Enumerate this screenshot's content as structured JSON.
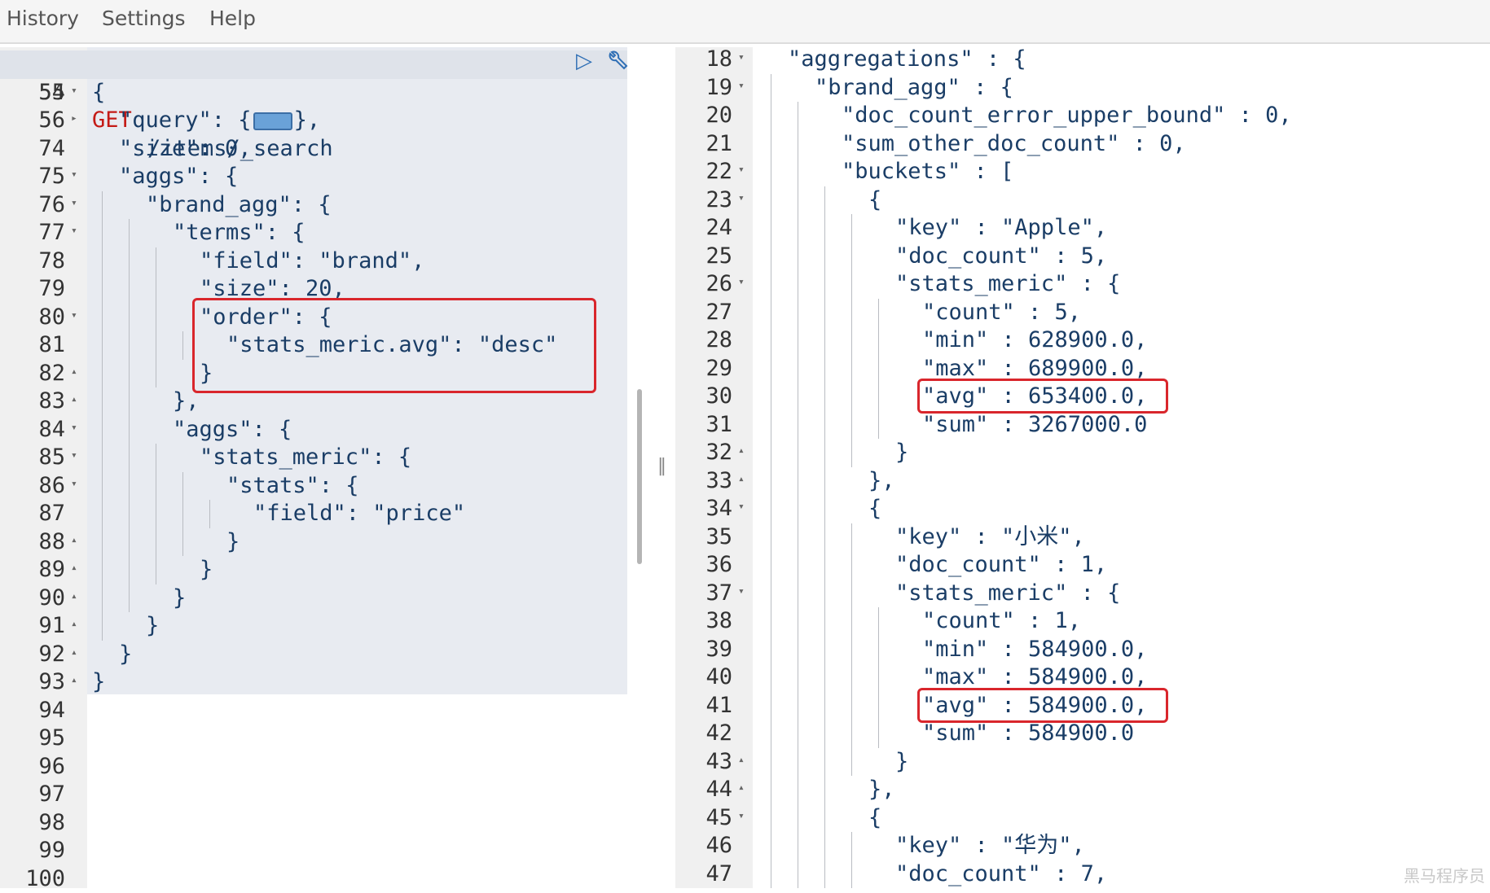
{
  "menu": {
    "history": "History",
    "settings": "Settings",
    "help": "Help"
  },
  "request": {
    "method": "GET",
    "path": "/items/_search",
    "lines": [
      {
        "num": "55",
        "fold": "▾",
        "indent": 0,
        "text": "{"
      },
      {
        "num": "56",
        "fold": "▸",
        "indent": 1,
        "text": "\"query\": {",
        "collapsed": true,
        "after": "},"
      },
      {
        "num": "74",
        "fold": "",
        "indent": 1,
        "text": "\"size\": 0,"
      },
      {
        "num": "75",
        "fold": "▾",
        "indent": 1,
        "text": "\"aggs\": {"
      },
      {
        "num": "76",
        "fold": "▾",
        "indent": 2,
        "text": "\"brand_agg\": {"
      },
      {
        "num": "77",
        "fold": "▾",
        "indent": 3,
        "text": "\"terms\": {"
      },
      {
        "num": "78",
        "fold": "",
        "indent": 4,
        "text": "\"field\": \"brand\","
      },
      {
        "num": "79",
        "fold": "",
        "indent": 4,
        "text": "\"size\": 20,"
      },
      {
        "num": "80",
        "fold": "▾",
        "indent": 4,
        "text": "\"order\": {"
      },
      {
        "num": "81",
        "fold": "",
        "indent": 5,
        "text": "\"stats_meric.avg\": \"desc\""
      },
      {
        "num": "82",
        "fold": "▴",
        "indent": 4,
        "text": "}"
      },
      {
        "num": "83",
        "fold": "▴",
        "indent": 3,
        "text": "},"
      },
      {
        "num": "84",
        "fold": "▾",
        "indent": 3,
        "text": "\"aggs\": {"
      },
      {
        "num": "85",
        "fold": "▾",
        "indent": 4,
        "text": "\"stats_meric\": {"
      },
      {
        "num": "86",
        "fold": "▾",
        "indent": 5,
        "text": "\"stats\": {"
      },
      {
        "num": "87",
        "fold": "",
        "indent": 6,
        "text": "\"field\": \"price\""
      },
      {
        "num": "88",
        "fold": "▴",
        "indent": 5,
        "text": "}"
      },
      {
        "num": "89",
        "fold": "▴",
        "indent": 4,
        "text": "}"
      },
      {
        "num": "90",
        "fold": "▴",
        "indent": 3,
        "text": "}"
      },
      {
        "num": "91",
        "fold": "▴",
        "indent": 2,
        "text": "}"
      },
      {
        "num": "92",
        "fold": "▴",
        "indent": 1,
        "text": "}"
      },
      {
        "num": "93",
        "fold": "▴",
        "indent": 0,
        "text": "}"
      },
      {
        "num": "94",
        "fold": "",
        "indent": 0,
        "text": ""
      },
      {
        "num": "95",
        "fold": "",
        "indent": 0,
        "text": ""
      },
      {
        "num": "96",
        "fold": "",
        "indent": 0,
        "text": ""
      },
      {
        "num": "97",
        "fold": "",
        "indent": 0,
        "text": ""
      },
      {
        "num": "98",
        "fold": "",
        "indent": 0,
        "text": ""
      },
      {
        "num": "99",
        "fold": "",
        "indent": 0,
        "text": ""
      },
      {
        "num": "100",
        "fold": "",
        "indent": 0,
        "text": ""
      }
    ],
    "first_line_num": "54"
  },
  "response": {
    "lines": [
      {
        "num": "18",
        "fold": "▾",
        "indent": 1,
        "text": "\"aggregations\" : {"
      },
      {
        "num": "19",
        "fold": "▾",
        "indent": 2,
        "text": "\"brand_agg\" : {"
      },
      {
        "num": "20",
        "fold": "",
        "indent": 3,
        "text": "\"doc_count_error_upper_bound\" : 0,"
      },
      {
        "num": "21",
        "fold": "",
        "indent": 3,
        "text": "\"sum_other_doc_count\" : 0,"
      },
      {
        "num": "22",
        "fold": "▾",
        "indent": 3,
        "text": "\"buckets\" : ["
      },
      {
        "num": "23",
        "fold": "▾",
        "indent": 4,
        "text": "{"
      },
      {
        "num": "24",
        "fold": "",
        "indent": 5,
        "text": "\"key\" : \"Apple\","
      },
      {
        "num": "25",
        "fold": "",
        "indent": 5,
        "text": "\"doc_count\" : 5,"
      },
      {
        "num": "26",
        "fold": "▾",
        "indent": 5,
        "text": "\"stats_meric\" : {"
      },
      {
        "num": "27",
        "fold": "",
        "indent": 6,
        "text": "\"count\" : 5,"
      },
      {
        "num": "28",
        "fold": "",
        "indent": 6,
        "text": "\"min\" : 628900.0,"
      },
      {
        "num": "29",
        "fold": "",
        "indent": 6,
        "text": "\"max\" : 689900.0,"
      },
      {
        "num": "30",
        "fold": "",
        "indent": 6,
        "text": "\"avg\" : 653400.0,"
      },
      {
        "num": "31",
        "fold": "",
        "indent": 6,
        "text": "\"sum\" : 3267000.0"
      },
      {
        "num": "32",
        "fold": "▴",
        "indent": 5,
        "text": "}"
      },
      {
        "num": "33",
        "fold": "▴",
        "indent": 4,
        "text": "},"
      },
      {
        "num": "34",
        "fold": "▾",
        "indent": 4,
        "text": "{"
      },
      {
        "num": "35",
        "fold": "",
        "indent": 5,
        "text": "\"key\" : \"小米\","
      },
      {
        "num": "36",
        "fold": "",
        "indent": 5,
        "text": "\"doc_count\" : 1,"
      },
      {
        "num": "37",
        "fold": "▾",
        "indent": 5,
        "text": "\"stats_meric\" : {"
      },
      {
        "num": "38",
        "fold": "",
        "indent": 6,
        "text": "\"count\" : 1,"
      },
      {
        "num": "39",
        "fold": "",
        "indent": 6,
        "text": "\"min\" : 584900.0,"
      },
      {
        "num": "40",
        "fold": "",
        "indent": 6,
        "text": "\"max\" : 584900.0,"
      },
      {
        "num": "41",
        "fold": "",
        "indent": 6,
        "text": "\"avg\" : 584900.0,"
      },
      {
        "num": "42",
        "fold": "",
        "indent": 6,
        "text": "\"sum\" : 584900.0"
      },
      {
        "num": "43",
        "fold": "▴",
        "indent": 5,
        "text": "}"
      },
      {
        "num": "44",
        "fold": "▴",
        "indent": 4,
        "text": "},"
      },
      {
        "num": "45",
        "fold": "▾",
        "indent": 4,
        "text": "{"
      },
      {
        "num": "46",
        "fold": "",
        "indent": 5,
        "text": "\"key\" : \"华为\","
      },
      {
        "num": "47",
        "fold": "",
        "indent": 5,
        "text": "\"doc_count\" : 7,"
      }
    ]
  },
  "icons": {
    "run": "play-icon",
    "settings": "wrench-icon"
  },
  "divider_glyph": "‖",
  "watermark": "黑马程序员"
}
